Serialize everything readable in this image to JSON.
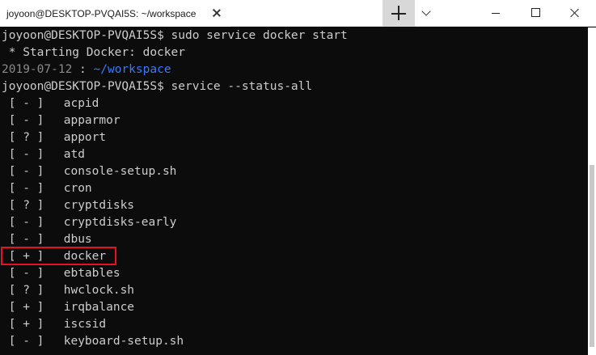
{
  "window": {
    "tab_title": "joyoon@DESKTOP-PVQAI5S: ~/workspace"
  },
  "terminal": {
    "lines": [
      {
        "user": "joyoon@DESKTOP-PVQAI5S",
        "sep": "$",
        "cmd": " sudo service docker start"
      },
      {
        "text": " * Starting Docker: docker"
      },
      {
        "date": "2019-07-12",
        "sep1": " : ",
        "path": "~/workspace"
      },
      {
        "user": "joyoon@DESKTOP-PVQAI5S",
        "sep": "$",
        "cmd": " service --status-all"
      }
    ],
    "services": [
      {
        "status": "[ - ]",
        "name": "acpid"
      },
      {
        "status": "[ - ]",
        "name": "apparmor"
      },
      {
        "status": "[ ? ]",
        "name": "apport"
      },
      {
        "status": "[ - ]",
        "name": "atd"
      },
      {
        "status": "[ - ]",
        "name": "console-setup.sh"
      },
      {
        "status": "[ - ]",
        "name": "cron"
      },
      {
        "status": "[ ? ]",
        "name": "cryptdisks"
      },
      {
        "status": "[ - ]",
        "name": "cryptdisks-early"
      },
      {
        "status": "[ - ]",
        "name": "dbus"
      },
      {
        "status": "[ + ]",
        "name": "docker"
      },
      {
        "status": "[ - ]",
        "name": "ebtables"
      },
      {
        "status": "[ ? ]",
        "name": "hwclock.sh"
      },
      {
        "status": "[ + ]",
        "name": "irqbalance"
      },
      {
        "status": "[ + ]",
        "name": "iscsid"
      },
      {
        "status": "[ - ]",
        "name": "keyboard-setup.sh"
      }
    ]
  },
  "colors": {
    "background": "#0c0c0c",
    "text": "#cccccc",
    "path": "#3b78ff",
    "date": "#8a8a8a",
    "highlight": "#e81123"
  }
}
